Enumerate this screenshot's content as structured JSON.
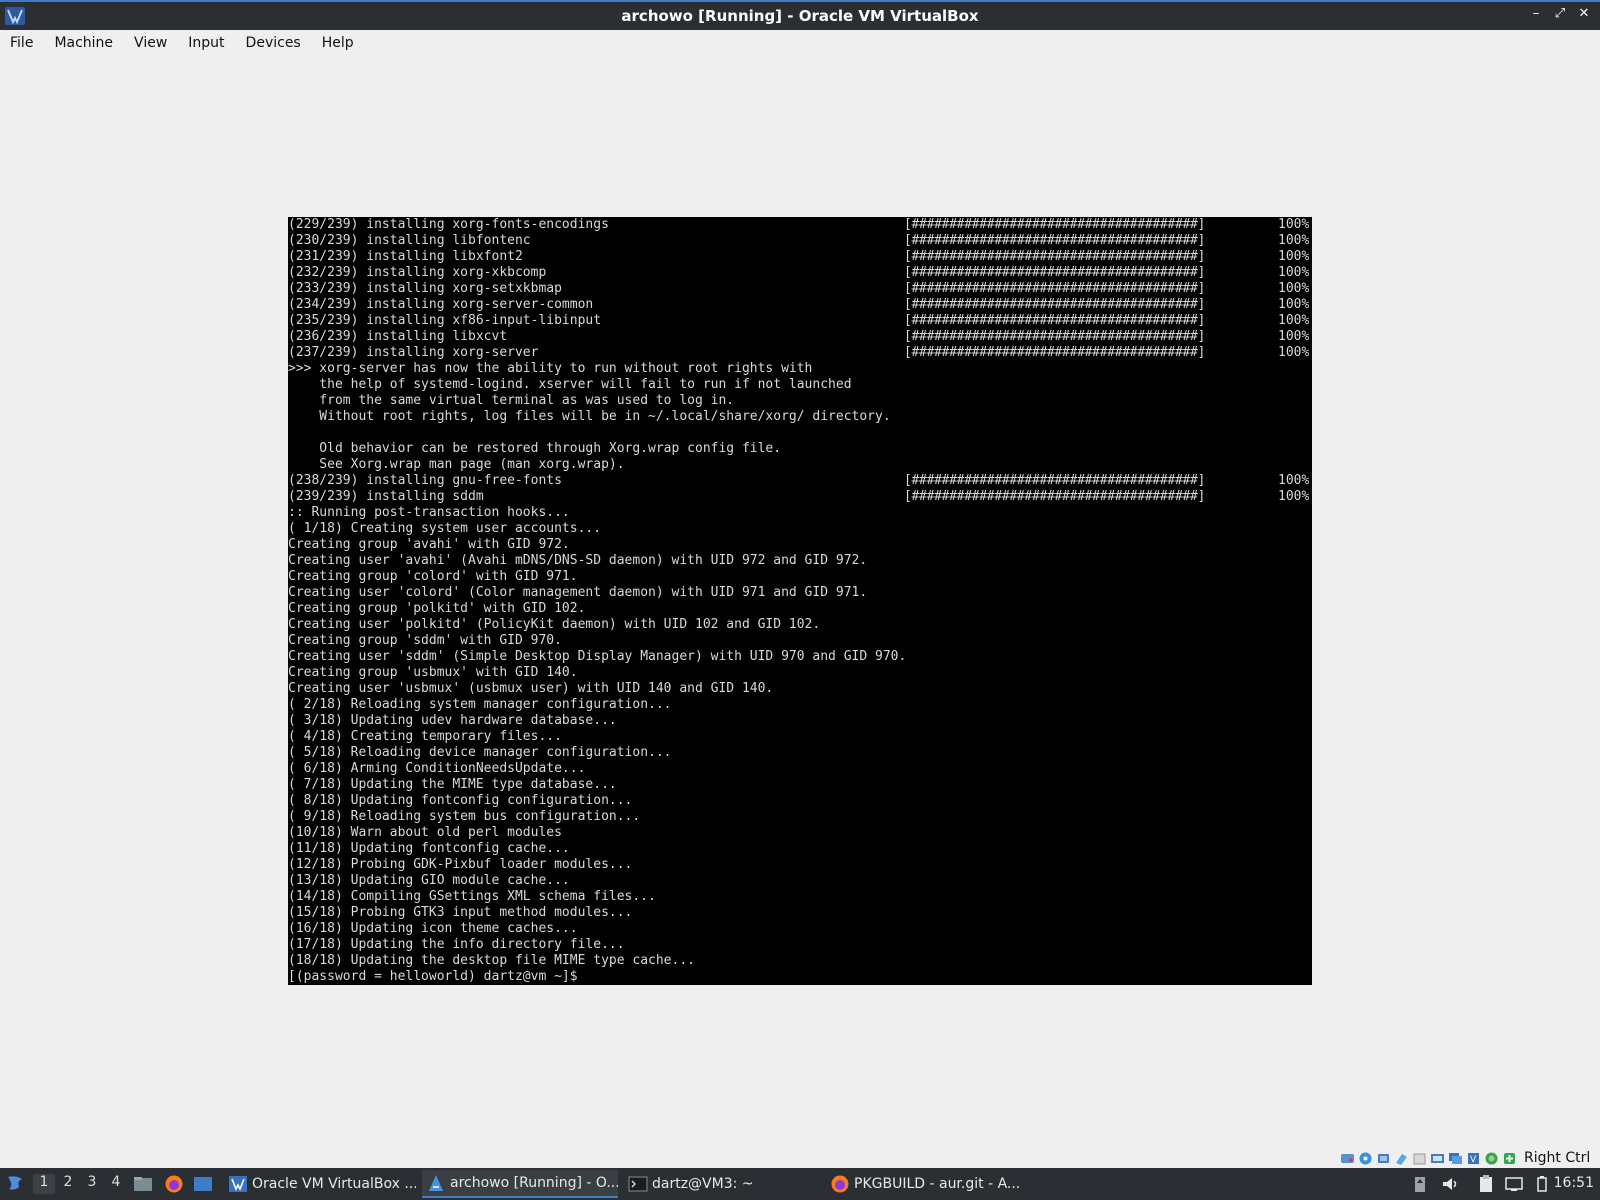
{
  "window": {
    "title": "archowo [Running] - Oracle VM VirtualBox",
    "minimize": "–",
    "maximize": "⤢",
    "close": "✕"
  },
  "menu": [
    "File",
    "Machine",
    "View",
    "Input",
    "Devices",
    "Help"
  ],
  "terminal": {
    "lines": [
      {
        "text": "(229/239) installing xorg-fonts-encodings",
        "bar": "[######################################]",
        "pct": "100%"
      },
      {
        "text": "(230/239) installing libfontenc",
        "bar": "[######################################]",
        "pct": "100%"
      },
      {
        "text": "(231/239) installing libxfont2",
        "bar": "[######################################]",
        "pct": "100%"
      },
      {
        "text": "(232/239) installing xorg-xkbcomp",
        "bar": "[######################################]",
        "pct": "100%"
      },
      {
        "text": "(233/239) installing xorg-setxkbmap",
        "bar": "[######################################]",
        "pct": "100%"
      },
      {
        "text": "(234/239) installing xorg-server-common",
        "bar": "[######################################]",
        "pct": "100%"
      },
      {
        "text": "(235/239) installing xf86-input-libinput",
        "bar": "[######################################]",
        "pct": "100%"
      },
      {
        "text": "(236/239) installing libxcvt",
        "bar": "[######################################]",
        "pct": "100%"
      },
      {
        "text": "(237/239) installing xorg-server",
        "bar": "[######################################]",
        "pct": "100%"
      },
      {
        "text": ">>> xorg-server has now the ability to run without root rights with"
      },
      {
        "text": "    the help of systemd-logind. xserver will fail to run if not launched"
      },
      {
        "text": "    from the same virtual terminal as was used to log in."
      },
      {
        "text": "    Without root rights, log files will be in ~/.local/share/xorg/ directory."
      },
      {
        "text": ""
      },
      {
        "text": "    Old behavior can be restored through Xorg.wrap config file."
      },
      {
        "text": "    See Xorg.wrap man page (man xorg.wrap)."
      },
      {
        "text": "(238/239) installing gnu-free-fonts",
        "bar": "[######################################]",
        "pct": "100%"
      },
      {
        "text": "(239/239) installing sddm",
        "bar": "[######################################]",
        "pct": "100%"
      },
      {
        "text": ":: Running post-transaction hooks..."
      },
      {
        "text": "( 1/18) Creating system user accounts..."
      },
      {
        "text": "Creating group 'avahi' with GID 972."
      },
      {
        "text": "Creating user 'avahi' (Avahi mDNS/DNS-SD daemon) with UID 972 and GID 972."
      },
      {
        "text": "Creating group 'colord' with GID 971."
      },
      {
        "text": "Creating user 'colord' (Color management daemon) with UID 971 and GID 971."
      },
      {
        "text": "Creating group 'polkitd' with GID 102."
      },
      {
        "text": "Creating user 'polkitd' (PolicyKit daemon) with UID 102 and GID 102."
      },
      {
        "text": "Creating group 'sddm' with GID 970."
      },
      {
        "text": "Creating user 'sddm' (Simple Desktop Display Manager) with UID 970 and GID 970."
      },
      {
        "text": "Creating group 'usbmux' with GID 140."
      },
      {
        "text": "Creating user 'usbmux' (usbmux user) with UID 140 and GID 140."
      },
      {
        "text": "( 2/18) Reloading system manager configuration..."
      },
      {
        "text": "( 3/18) Updating udev hardware database..."
      },
      {
        "text": "( 4/18) Creating temporary files..."
      },
      {
        "text": "( 5/18) Reloading device manager configuration..."
      },
      {
        "text": "( 6/18) Arming ConditionNeedsUpdate..."
      },
      {
        "text": "( 7/18) Updating the MIME type database..."
      },
      {
        "text": "( 8/18) Updating fontconfig configuration..."
      },
      {
        "text": "( 9/18) Reloading system bus configuration..."
      },
      {
        "text": "(10/18) Warn about old perl modules"
      },
      {
        "text": "(11/18) Updating fontconfig cache..."
      },
      {
        "text": "(12/18) Probing GDK-Pixbuf loader modules..."
      },
      {
        "text": "(13/18) Updating GIO module cache..."
      },
      {
        "text": "(14/18) Compiling GSettings XML schema files..."
      },
      {
        "text": "(15/18) Probing GTK3 input method modules..."
      },
      {
        "text": "(16/18) Updating icon theme caches..."
      },
      {
        "text": "(17/18) Updating the info directory file..."
      },
      {
        "text": "(18/18) Updating the desktop file MIME type cache..."
      },
      {
        "text": "[(password = helloworld) dartz@vm ~]$"
      }
    ]
  },
  "statusbar": {
    "host_key": "Right Ctrl",
    "icons": [
      "hard-disk-icon",
      "optical-drive-icon",
      "audio-icon",
      "network-icon",
      "usb-icon",
      "shared-folder-icon",
      "display-icon",
      "recording-icon",
      "cpu-icon",
      "mouse-integration-icon",
      "keyboard-icon"
    ]
  },
  "taskbar": {
    "workspaces": [
      "1",
      "2",
      "3",
      "4"
    ],
    "active_workspace": "1",
    "tasks": [
      {
        "label": "Oracle VM VirtualBox ...",
        "icon": "virtualbox-icon"
      },
      {
        "label": "archowo [Running] - O...",
        "icon": "virtualbox-vm-icon",
        "active": true
      },
      {
        "label": "dartz@VM3: ~",
        "icon": "terminal-icon"
      },
      {
        "label": "PKGBUILD - aur.git - A...",
        "icon": "firefox-icon"
      }
    ],
    "clock": "16:51"
  },
  "colors": {
    "accent": "#3d7cc9",
    "panel": "#2b2f33",
    "window_bg": "#efefef",
    "terminal_bg": "#000000",
    "terminal_fg": "#d8d8d8"
  }
}
